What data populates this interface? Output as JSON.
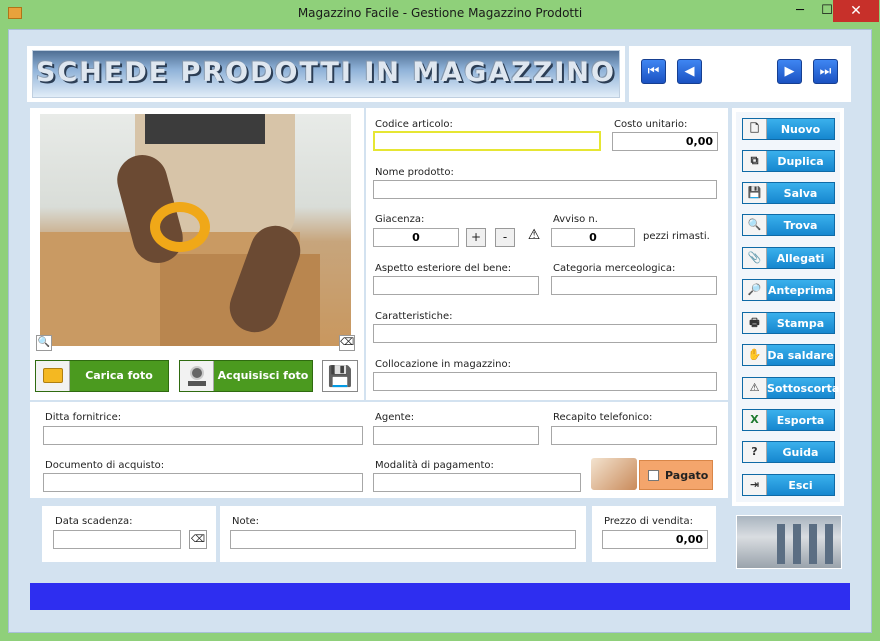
{
  "window": {
    "title": "Magazzino Facile - Gestione Magazzino Prodotti",
    "minimize": "─",
    "maximize": "☐",
    "close": "✕"
  },
  "header": {
    "banner": "SCHEDE PRODOTTI IN MAGAZZINO"
  },
  "nav": {
    "first": "⏮",
    "prev": "◀",
    "next": "▶",
    "last": "⏭"
  },
  "photo": {
    "carica_label": "Carica foto",
    "acquisisci_label": "Acquisisci foto",
    "zoom_glyph": "🔍",
    "erase_glyph": "⌫",
    "save_glyph": "💾"
  },
  "form": {
    "codice_label": "Codice articolo:",
    "codice_value": "",
    "costo_label": "Costo unitario:",
    "costo_value": "0,00",
    "nome_label": "Nome prodotto:",
    "nome_value": "",
    "giacenza_label": "Giacenza:",
    "giacenza_value": "0",
    "plus": "+",
    "minus": "-",
    "warn_glyph": "⚠",
    "avviso_label": "Avviso n.",
    "avviso_value": "0",
    "pezzi_label": "pezzi rimasti.",
    "aspetto_label": "Aspetto esteriore del bene:",
    "aspetto_value": "",
    "categoria_label": "Categoria merceologica:",
    "categoria_value": "",
    "caratteristiche_label": "Caratteristiche:",
    "caratteristiche_value": "",
    "collocazione_label": "Collocazione in magazzino:",
    "collocazione_value": "",
    "ditta_label": "Ditta fornitrice:",
    "ditta_value": "",
    "agente_label": "Agente:",
    "agente_value": "",
    "recapito_label": "Recapito telefonico:",
    "recapito_value": "",
    "documento_label": "Documento di acquisto:",
    "documento_value": "",
    "modalita_label": "Modalità di pagamento:",
    "modalita_value": "",
    "pagato_label": "Pagato",
    "data_label": "Data scadenza:",
    "data_value": "",
    "note_label": "Note:",
    "note_value": "",
    "prezzo_label": "Prezzo di vendita:",
    "prezzo_value": "0,00"
  },
  "sidebar": {
    "items": [
      {
        "label": "Nuovo",
        "icon": "🗋"
      },
      {
        "label": "Duplica",
        "icon": "⧉"
      },
      {
        "label": "Salva",
        "icon": "💾"
      },
      {
        "label": "Trova",
        "icon": "🔍"
      },
      {
        "label": "Allegati",
        "icon": "📎"
      },
      {
        "label": "Anteprima",
        "icon": "🔎"
      },
      {
        "label": "Stampa",
        "icon": "🖶"
      },
      {
        "label": "Da saldare",
        "icon": "✋"
      },
      {
        "label": "Sottoscorta",
        "icon": "⚠"
      },
      {
        "label": "Esporta",
        "icon": "X"
      },
      {
        "label": "Guida",
        "icon": "?"
      },
      {
        "label": "Esci",
        "icon": "⇥"
      }
    ]
  }
}
